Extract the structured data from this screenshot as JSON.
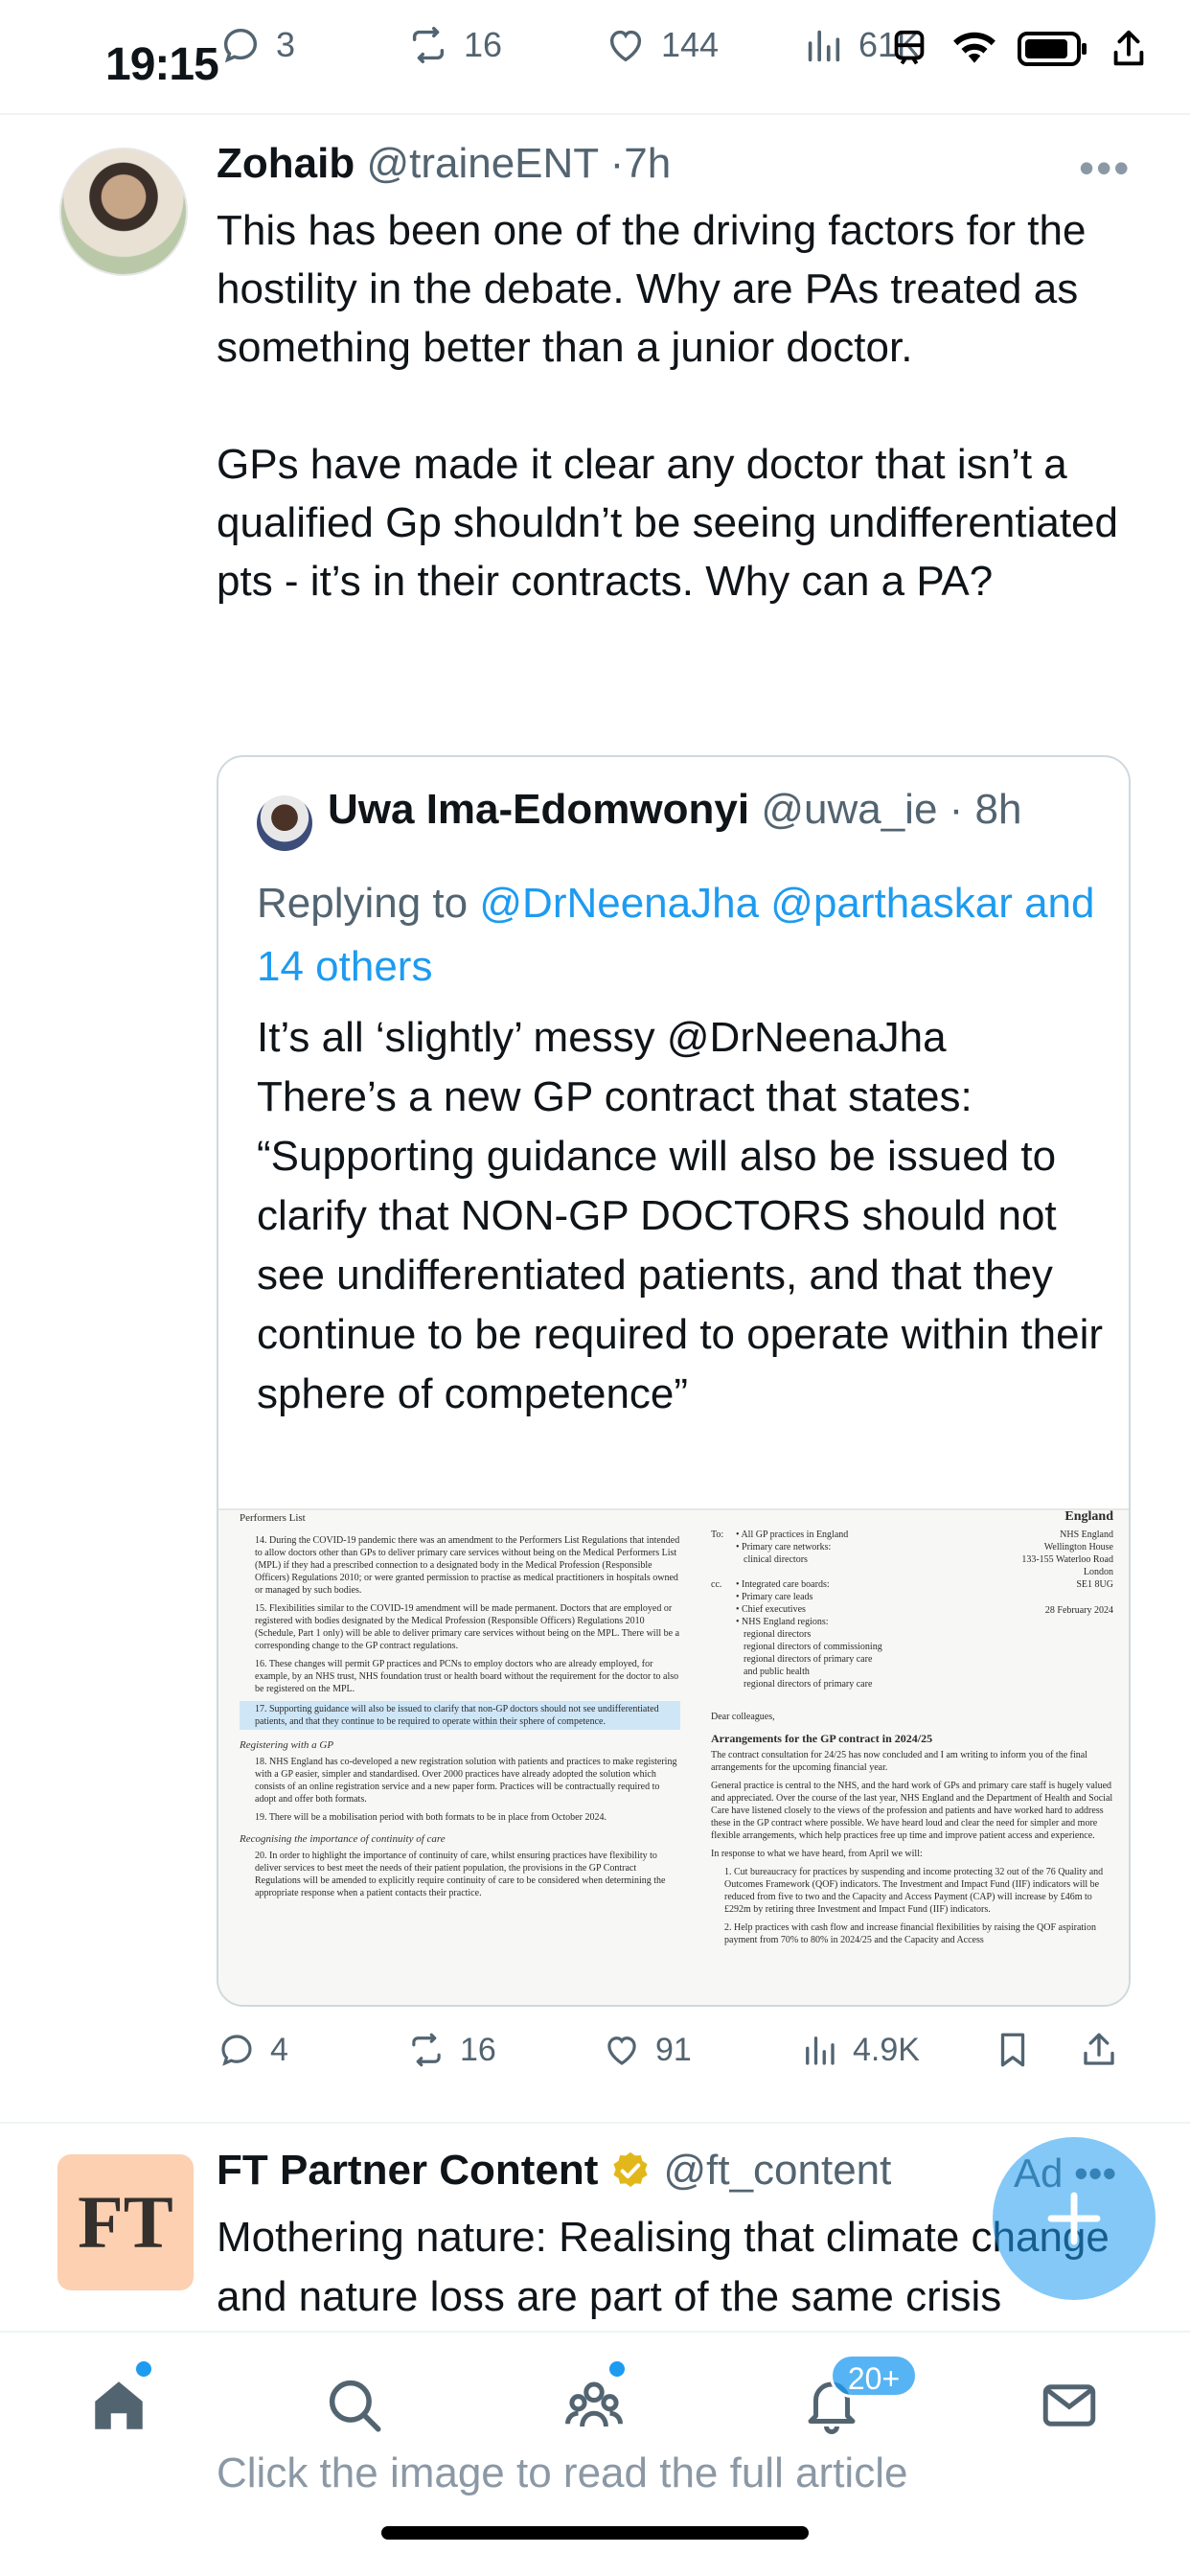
{
  "status_bar": {
    "time": "19:15"
  },
  "overlay_actions": {
    "replies": "3",
    "reposts": "16",
    "likes": "144",
    "views": "61K"
  },
  "tweet": {
    "author_name": "Zohaib",
    "handle": "@traineENT",
    "time": "7h",
    "text": "This has been one of the driving factors for the hostility in the debate. Why are PAs treated as something better than a junior doctor.\n\nGPs have made it clear any doctor that isn’t a qualified Gp shouldn’t be seeing undifferentiated pts - it’s in their contracts. Why can a PA?",
    "actions": {
      "replies": "4",
      "reposts": "16",
      "likes": "91",
      "views": "4.9K"
    }
  },
  "quote": {
    "author_name": "Uwa Ima-Edomwonyi",
    "handle": "@uwa_ie",
    "time": "8h",
    "reply_prefix": "Replying to",
    "reply_mentions": "@DrNeenaJha @parthaskar",
    "reply_others": "and 14 others",
    "text": "It’s all ‘slightly’ messy @DrNeenaJha\nThere’s a new GP contract that states:\n“Supporting guidance will also be issued to clarify that NON-GP DOCTORS should not see undifferentiated patients, and that they continue to be required to operate within their sphere of competence”",
    "document": {
      "left_top": "Performers List",
      "right_top": "England",
      "item14": "14. During the COVID-19 pandemic there was an amendment to the Performers List Regulations that intended to allow doctors other than GPs to deliver primary care services without being on the Medical Performers List (MPL) if they had a prescribed connection to a designated body in the Medical Profession (Responsible Officers) Regulations 2010; or were granted permission to practise as medical practitioners in hospitals owned or managed by such bodies.",
      "item15": "15. Flexibilities similar to the COVID-19 amendment will be made permanent. Doctors that are employed or registered with bodies designated by the Medical Profession (Responsible Officers) Regulations 2010 (Schedule, Part 1 only) will be able to deliver primary care services without being on the MPL. There will be a corresponding change to the GP contract regulations.",
      "item16": "16. These changes will permit GP practices and PCNs to employ doctors who are already employed, for example, by an NHS trust, NHS foundation trust or health board without the requirement for the doctor to also be registered on the MPL.",
      "item17": "17. Supporting guidance will also be issued to clarify that non-GP doctors should not see undifferentiated patients, and that they continue to be required to operate within their sphere of competence.",
      "heading_registering": "Registering with a GP",
      "item18": "18. NHS England has co-developed a new registration solution with patients and practices to make registering with a GP easier, simpler and standardised. Over 2000 practices have already adopted the solution which consists of an online registration service and a new paper form. Practices will be contractually required to adopt and offer both formats.",
      "item19": "19. There will be a mobilisation period with both formats to be in place from October 2024.",
      "heading_continuity": "Recognising the importance of continuity of care",
      "item20": "20. In order to highlight the importance of continuity of care, whilst ensuring practices have flexibility to deliver services to best meet the needs of their patient population, the provisions in the GP Contract Regulations will be amended to explicitly require continuity of care to be considered when determining the appropriate response when a patient contacts their practice.",
      "to_label": "To:",
      "to_lines": [
        "• All GP practices in England",
        "• Primary care networks:",
        "clinical directors"
      ],
      "cc_label": "cc.",
      "cc_lines": [
        "• Integrated care boards:",
        "• Primary care leads",
        "• Chief executives",
        "• NHS England regions:",
        "regional directors",
        "regional directors of commissioning",
        "regional directors of primary care",
        "and public health",
        "regional directors of primary care"
      ],
      "address_lines": [
        "NHS England",
        "Wellington House",
        "133-155 Waterloo Road",
        "London",
        "SE1 8UG"
      ],
      "date": "28 February 2024",
      "salutation": "Dear colleagues,",
      "arrangements_title": "Arrangements for the GP contract in 2024/25",
      "para1": "The contract consultation for 24/25 has now concluded and I am writing to inform you of the final arrangements for the upcoming financial year.",
      "para2": "General practice is central to the NHS, and the hard work of GPs and primary care staff is hugely valued and appreciated. Over the course of the last year, NHS England and the Department of Health and Social Care have listened closely to the views of the profession and patients and have worked hard to address these in the GP contract where possible. We have heard loud and clear the need for simpler and more flexible arrangements, which help practices free up time and improve patient access and experience.",
      "para3": "In response to what we have heard, from April we will:",
      "point1": "1. Cut bureaucracy for practices by suspending and income protecting 32 out of the 76 Quality and Outcomes Framework (QOF) indicators. The Investment and Impact Fund (IIF) indicators will be reduced from five to two and the Capacity and Access Payment (CAP) will increase by £46m to £292m by retiring three Investment and Impact Fund (IIF) indicators.",
      "point2": "2. Help practices with cash flow and increase financial flexibilities by raising the QOF aspiration payment from 70% to 80% in 2024/25 and the Capacity and Access"
    }
  },
  "ad": {
    "logo_text": "FT",
    "author_name": "FT Partner Content",
    "handle": "@ft_content",
    "ad_label": "Ad",
    "text": "Mothering nature: Realising that climate change and nature loss are part of the same crisis",
    "footer_hint": "Click the image to read the full article"
  },
  "bottom_nav": {
    "notifications_badge": "20+"
  }
}
